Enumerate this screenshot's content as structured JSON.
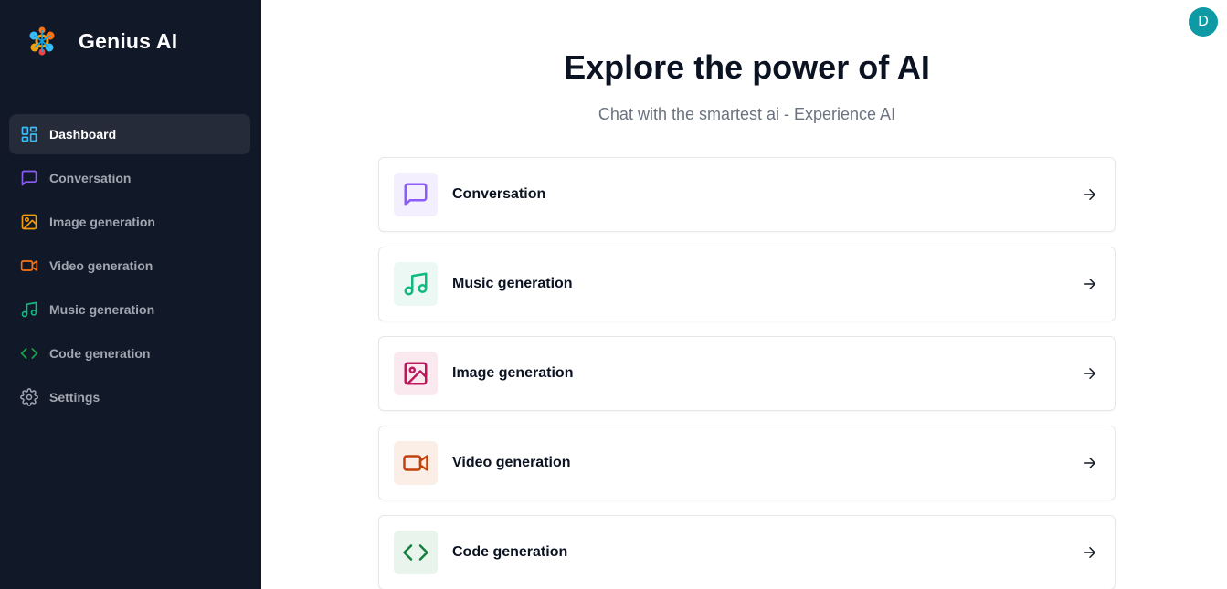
{
  "app": {
    "name": "Genius AI"
  },
  "header": {
    "avatar_initial": "D"
  },
  "sidebar": {
    "items": [
      {
        "label": "Dashboard",
        "icon": "dashboard-icon",
        "color": "#38bdf8",
        "active": true
      },
      {
        "label": "Conversation",
        "icon": "message-icon",
        "color": "#8b5cf6"
      },
      {
        "label": "Image generation",
        "icon": "image-icon",
        "color": "#f59e0b"
      },
      {
        "label": "Video generation",
        "icon": "video-icon",
        "color": "#f97316"
      },
      {
        "label": "Music generation",
        "icon": "music-icon",
        "color": "#10b981"
      },
      {
        "label": "Code generation",
        "icon": "code-icon",
        "color": "#16a34a"
      },
      {
        "label": "Settings",
        "icon": "gear-icon",
        "color": "#a1a6b0"
      }
    ]
  },
  "main": {
    "title": "Explore the power of AI",
    "subtitle": "Chat with the smartest ai - Experience AI",
    "cards": [
      {
        "label": "Conversation",
        "icon": "message-icon",
        "color": "#8b5cf6",
        "bg": "#f3effe"
      },
      {
        "label": "Music generation",
        "icon": "music-icon",
        "color": "#10b981",
        "bg": "#ebf8f3"
      },
      {
        "label": "Image generation",
        "icon": "image-icon",
        "color": "#be185d",
        "bg": "#fbe9f0"
      },
      {
        "label": "Video generation",
        "icon": "video-icon",
        "color": "#c2410c",
        "bg": "#fbeee6"
      },
      {
        "label": "Code generation",
        "icon": "code-icon",
        "color": "#15803d",
        "bg": "#e9f4ec"
      }
    ]
  }
}
